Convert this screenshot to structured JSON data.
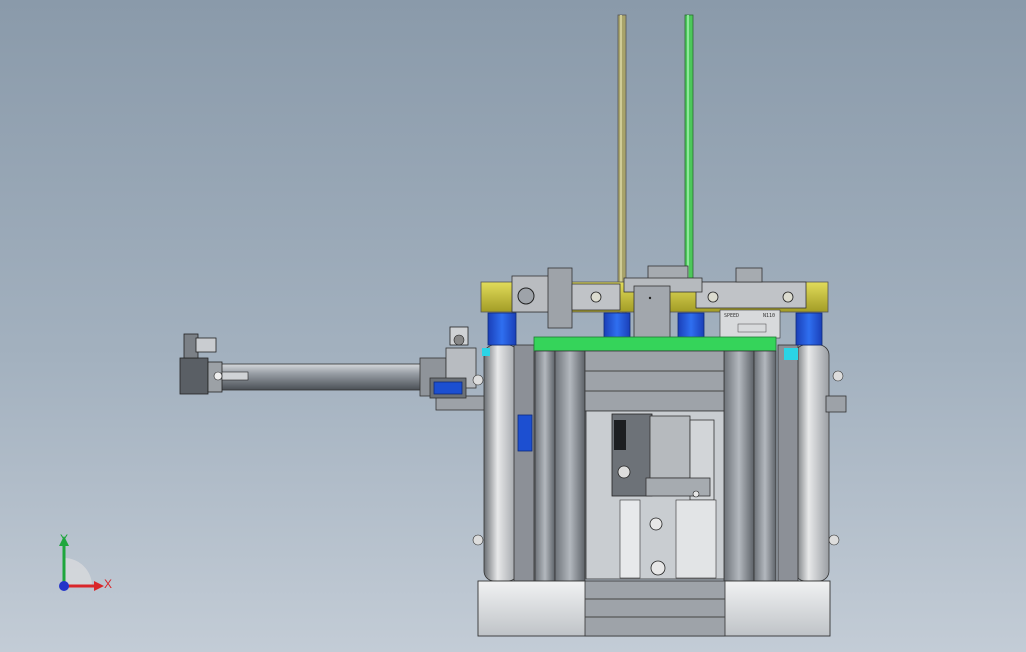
{
  "triad": {
    "x_label": "X",
    "y_label": "Y",
    "x_color": "#d9262a",
    "y_color": "#1ea63c",
    "z_color": "#2335c9"
  },
  "nameplate": {
    "left_text": "SPEED",
    "right_text": "N110"
  },
  "colors": {
    "background_top": "#8a9aaa",
    "background_bottom": "#c3ccd6",
    "gold_plate": "#c9c23a",
    "blue_block": "#1c4fd1",
    "green_plate": "#35d45a",
    "green_rod": "#4cc85a",
    "khaki_rod": "#a8a36a",
    "cyan_accent": "#2ad4e6",
    "frame_gray": "#8c9097"
  }
}
